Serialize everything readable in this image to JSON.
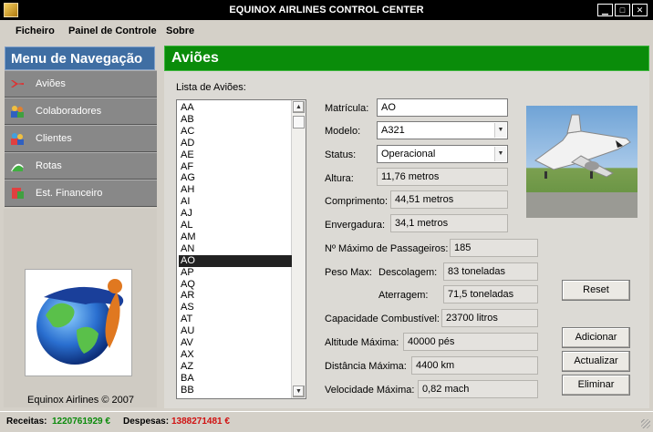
{
  "window": {
    "title": "EQUINOX AIRLINES CONTROL CENTER"
  },
  "menu": [
    "Ficheiro",
    "Painel de Controle",
    "Sobre"
  ],
  "nav": {
    "title": "Menu de Navegação",
    "items": [
      {
        "label": "Aviões",
        "icon": "airplane-icon"
      },
      {
        "label": "Colaboradores",
        "icon": "people-icon"
      },
      {
        "label": "Clientes",
        "icon": "clients-icon"
      },
      {
        "label": "Rotas",
        "icon": "routes-icon"
      },
      {
        "label": "Est. Financeiro",
        "icon": "finance-icon"
      }
    ],
    "footer": "Equinox Airlines © 2007"
  },
  "main": {
    "title": "Aviões",
    "list_label": "Lista de Aviões:",
    "list_items": [
      "AA",
      "AB",
      "AC",
      "AD",
      "AE",
      "AF",
      "AG",
      "AH",
      "AI",
      "AJ",
      "AL",
      "AM",
      "AN",
      "AO",
      "AP",
      "AQ",
      "AR",
      "AS",
      "AT",
      "AU",
      "AV",
      "AX",
      "AZ",
      "BA",
      "BB"
    ],
    "selected": "AO"
  },
  "form": {
    "matricula_label": "Matrícula:",
    "matricula_value": "AO",
    "modelo_label": "Modelo:",
    "modelo_value": "A321",
    "status_label": "Status:",
    "status_value": "Operacional",
    "altura_label": "Altura:",
    "altura_value": "11,76 metros",
    "comprimento_label": "Comprimento:",
    "comprimento_value": "44,51 metros",
    "envergadura_label": "Envergadura:",
    "envergadura_value": "34,1 metros",
    "passageiros_label": "Nº Máximo de Passageiros:",
    "passageiros_value": "185",
    "peso_label": "Peso Max:",
    "descolagem_label": "Descolagem:",
    "descolagem_value": "83 toneladas",
    "aterragem_label": "Aterragem:",
    "aterragem_value": "71,5 toneladas",
    "combustivel_label": "Capacidade Combustível:",
    "combustivel_value": "23700 litros",
    "altitude_label": "Altitude Máxima:",
    "altitude_value": "40000 pés",
    "distancia_label": "Distância Máxima:",
    "distancia_value": "4400 km",
    "velocidade_label": "Velocidade Máxima:",
    "velocidade_value": "0,82 mach"
  },
  "buttons": {
    "reset": "Reset",
    "adicionar": "Adicionar",
    "actualizar": "Actualizar",
    "eliminar": "Eliminar"
  },
  "status": {
    "receitas_label": "Receitas:",
    "receitas_value": "1220761929 €",
    "despesas_label": "Despesas:",
    "despesas_value": "1388271481 €"
  },
  "colors": {
    "nav_header": "#3f6ea3",
    "main_header": "#0a8c0a",
    "receitas": "#0a8a0a",
    "despesas": "#d01010"
  }
}
